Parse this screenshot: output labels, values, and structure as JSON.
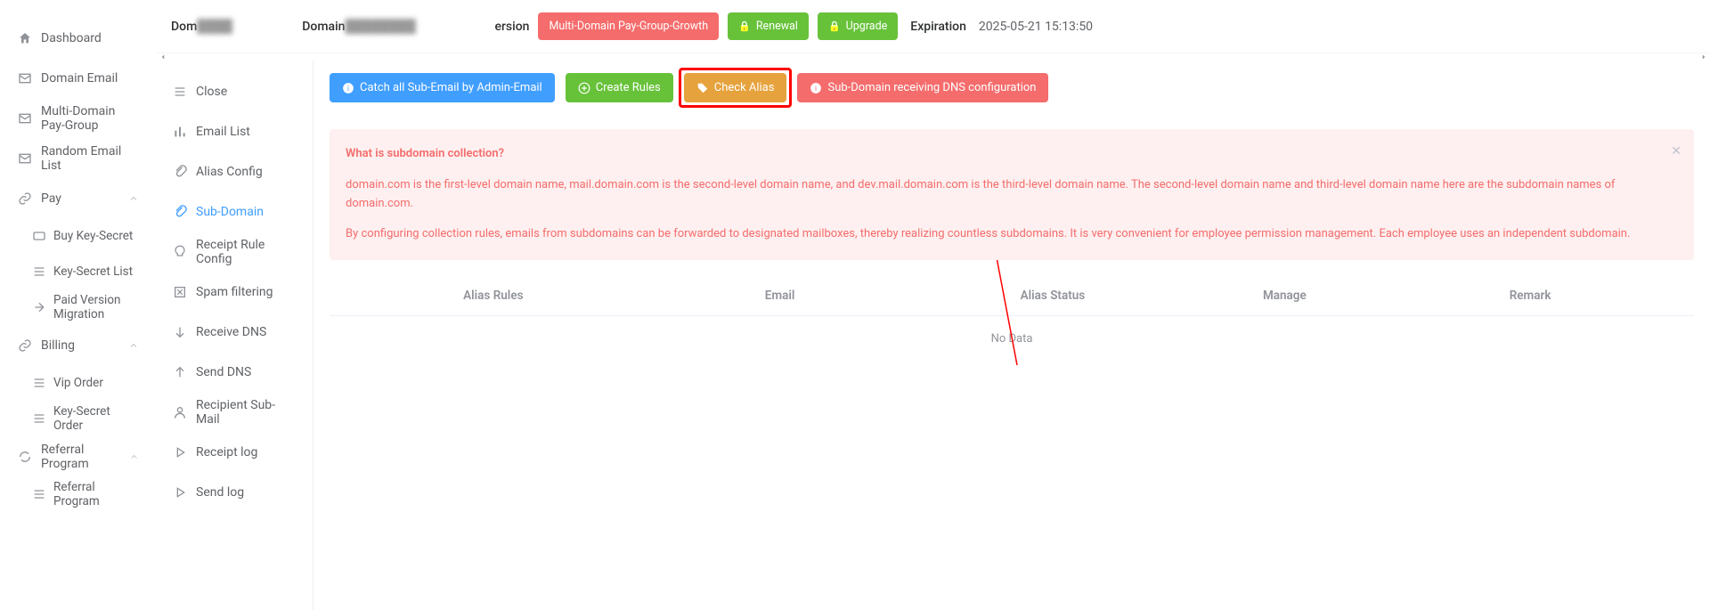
{
  "sidebar_main": {
    "items": [
      {
        "label": "Dashboard",
        "icon": "home"
      },
      {
        "label": "Domain Email",
        "icon": "mail"
      },
      {
        "label": "Multi-Domain Pay-Group",
        "icon": "mail"
      },
      {
        "label": "Random Email List",
        "icon": "mail"
      },
      {
        "label": "Pay",
        "icon": "link",
        "expand": true,
        "children": [
          {
            "label": "Buy Key-Secret",
            "icon": "wallet"
          },
          {
            "label": "Key-Secret List",
            "icon": "list"
          },
          {
            "label": "Paid Version Migration",
            "icon": "migrate"
          }
        ]
      },
      {
        "label": "Billing",
        "icon": "link",
        "expand": true,
        "children": [
          {
            "label": "Vip Order",
            "icon": "list"
          },
          {
            "label": "Key-Secret Order",
            "icon": "list"
          }
        ]
      },
      {
        "label": "Referral Program",
        "icon": "refresh",
        "expand": true,
        "children": [
          {
            "label": "Referral Program",
            "icon": "list"
          }
        ]
      }
    ]
  },
  "topbar": {
    "dom_label": "Dom",
    "dom_value": "[redacted]",
    "domain_label": "Domain",
    "domain_value": "[redacted]",
    "version_label": "ersion",
    "btn_plan": "Multi-Domain Pay-Group-Growth",
    "btn_renewal": "Renewal",
    "btn_upgrade": "Upgrade",
    "exp_label": "Expiration",
    "exp_value": "2025-05-21 15:13:50"
  },
  "submenu": {
    "items": [
      {
        "label": "Close",
        "icon": "close"
      },
      {
        "label": "Email List",
        "icon": "bars"
      },
      {
        "label": "Alias Config",
        "icon": "clip"
      },
      {
        "label": "Sub-Domain",
        "icon": "clip",
        "active": true
      },
      {
        "label": "Receipt Rule Config",
        "icon": "bulb"
      },
      {
        "label": "Spam filtering",
        "icon": "square-x"
      },
      {
        "label": "Receive DNS",
        "icon": "down"
      },
      {
        "label": "Send DNS",
        "icon": "up"
      },
      {
        "label": "Recipient Sub-Mail",
        "icon": "person"
      },
      {
        "label": "Receipt log",
        "icon": "play"
      },
      {
        "label": "Send log",
        "icon": "play"
      }
    ]
  },
  "actions": {
    "catch_all": "Catch all Sub-Email by Admin-Email",
    "create_rules": "Create Rules",
    "check_alias": "Check Alias",
    "dns_config": "Sub-Domain receiving DNS configuration"
  },
  "alert": {
    "title": "What is subdomain collection?",
    "p1": "domain.com is the first-level domain name, mail.domain.com is the second-level domain name, and dev.mail.domain.com is the third-level domain name. The second-level domain name and third-level domain name here are the subdomain names of domain.com.",
    "p2": "By configuring collection rules, emails from subdomains can be forwarded to designated mailboxes, thereby realizing countless subdomains. It is very convenient for employee permission management. Each employee uses an independent subdomain."
  },
  "table": {
    "headers": [
      "Alias Rules",
      "Email",
      "Alias Status",
      "Manage",
      "Remark"
    ],
    "empty": "No Data"
  }
}
